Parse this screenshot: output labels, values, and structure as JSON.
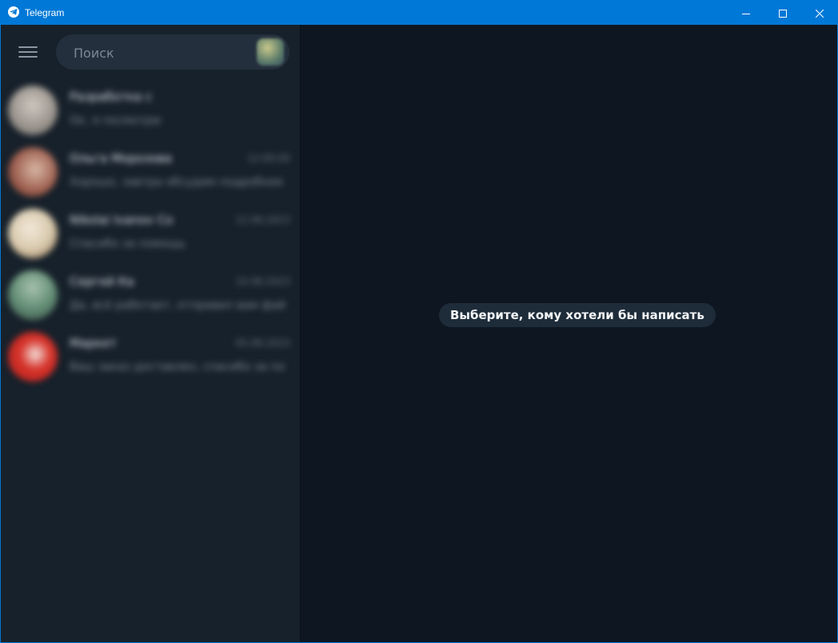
{
  "window": {
    "title": "Telegram",
    "accent_color": "#0078d7",
    "controls": {
      "minimize_icon": "minimize-icon",
      "maximize_icon": "maximize-icon",
      "close_icon": "close-icon"
    }
  },
  "sidebar": {
    "menu_icon": "hamburger-menu-icon",
    "search": {
      "placeholder": "Поиск",
      "value": ""
    },
    "chats": [
      {
        "name": "Разработка с",
        "time": "",
        "preview": "Ок, я посмотрю",
        "avatar_color": "#b9b2aa"
      },
      {
        "name": "Ольга Морозова",
        "time": "12:00:00",
        "preview": "Хорошо, завтра обсудим подробнее это всё",
        "avatar_color": "#9a5a4a"
      },
      {
        "name": "Nikolai Ivanov Co",
        "time": "12.08.2023",
        "preview": "Спасибо за помощь",
        "avatar_color": "#d9cbb0"
      },
      {
        "name": "Сергей Ка",
        "time": "10.08.2023",
        "preview": "Да, всё работает, отправил вам файлы",
        "avatar_color": "#5f8a72"
      },
      {
        "name": "Маркет",
        "time": "05.08.2023",
        "preview": "Ваш заказ доставлен, спасибо за покупку",
        "avatar_color": "#d6332a"
      }
    ]
  },
  "main": {
    "empty_message": "Выберите, кому хотели бы написать"
  }
}
